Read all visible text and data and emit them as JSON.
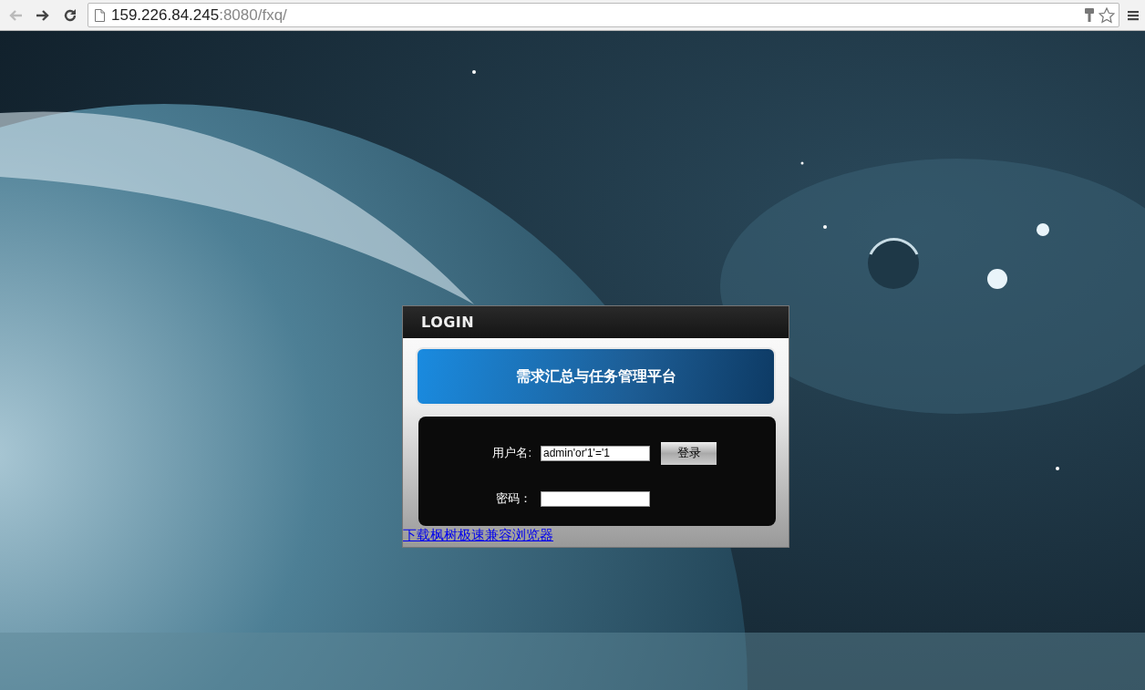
{
  "browser": {
    "back": {
      "disabled": true
    },
    "forward": {
      "disabled": false
    },
    "url_host": "159.226.84.245",
    "url_path": ":8080/fxq/"
  },
  "login": {
    "header": "LOGIN",
    "title": "需求汇总与任务管理平台",
    "fields": [
      {
        "label": "用户名:",
        "value": "admin'or'1'='1",
        "kind": "text"
      },
      {
        "label": "密码：",
        "kind": "password"
      }
    ],
    "submit": "登录",
    "link": "下载枫树极速兼容浏览器"
  }
}
